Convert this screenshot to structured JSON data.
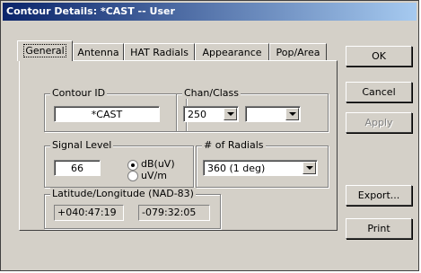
{
  "window": {
    "title": "Contour Details: *CAST -- User"
  },
  "tabs": [
    {
      "label": "General",
      "active": true
    },
    {
      "label": "Antenna"
    },
    {
      "label": "HAT Radials"
    },
    {
      "label": "Appearance"
    },
    {
      "label": "Pop/Area"
    }
  ],
  "contour_id": {
    "label": "Contour ID",
    "value": "*CAST"
  },
  "chan_class": {
    "label": "Chan/Class",
    "channel": "250",
    "class": ""
  },
  "signal_level": {
    "label": "Signal Level",
    "value": "66",
    "options": [
      {
        "label": "dB(uV)",
        "checked": true
      },
      {
        "label": "uV/m",
        "checked": false
      }
    ]
  },
  "radials": {
    "label": "# of Radials",
    "value": "360 (1 deg)"
  },
  "lat_long": {
    "label": "Latitude/Longitude (NAD-83)",
    "latitude": "+040:47:19",
    "longitude": "-079:32:05"
  },
  "buttons": {
    "ok": "OK",
    "cancel": "Cancel",
    "apply": "Apply",
    "export": "Export...",
    "print": "Print"
  }
}
